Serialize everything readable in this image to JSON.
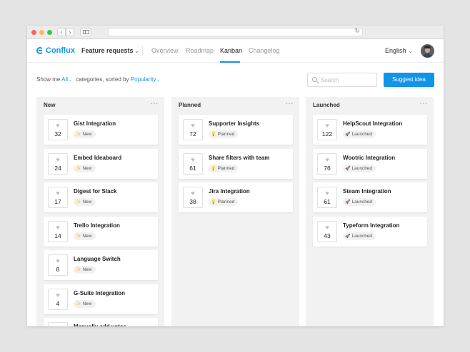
{
  "browser": {
    "back": "‹",
    "forward": "›",
    "reload": "↻"
  },
  "nav": {
    "logo": "Conflux",
    "product": "Feature requests",
    "tabs": [
      "Overview",
      "Roadmap",
      "Kanban",
      "Changelog"
    ],
    "active_tab": "Kanban",
    "language": "English",
    "chevron": "⌄"
  },
  "filter": {
    "prefix": "Show me",
    "category": "All",
    "middle": "categories, sorted by",
    "sort": "Popularity",
    "search_placeholder": "Search",
    "suggest_label": "Suggest idea"
  },
  "columns": [
    {
      "title": "New",
      "menu": "···",
      "cards": [
        {
          "title": "Gist Integration",
          "votes": "32",
          "status": "New",
          "status_icon": "✨"
        },
        {
          "title": "Embed Ideaboard",
          "votes": "24",
          "status": "New",
          "status_icon": "✨"
        },
        {
          "title": "Digest for Slack",
          "votes": "17",
          "status": "New",
          "status_icon": "✨"
        },
        {
          "title": "Trello Integration",
          "votes": "14",
          "status": "New",
          "status_icon": "✨"
        },
        {
          "title": "Language Switch",
          "votes": "8",
          "status": "New",
          "status_icon": "✨"
        },
        {
          "title": "G-Suite Integration",
          "votes": "4",
          "status": "New",
          "status_icon": "✨"
        },
        {
          "title": "Manually add votes",
          "votes": "",
          "status": "",
          "status_icon": ""
        }
      ]
    },
    {
      "title": "Planned",
      "menu": "···",
      "cards": [
        {
          "title": "Supporter Insights",
          "votes": "72",
          "status": "Planned",
          "status_icon": "💡"
        },
        {
          "title": "Share filters with team",
          "votes": "61",
          "status": "Planned",
          "status_icon": "💡"
        },
        {
          "title": "Jira Integration",
          "votes": "38",
          "status": "Planned",
          "status_icon": "💡"
        }
      ]
    },
    {
      "title": "Launched",
      "menu": "···",
      "cards": [
        {
          "title": "HelpScout Integration",
          "votes": "122",
          "status": "Launched",
          "status_icon": "🚀"
        },
        {
          "title": "Wootric Integration",
          "votes": "76",
          "status": "Launched",
          "status_icon": "🚀"
        },
        {
          "title": "Steam Integration",
          "votes": "61",
          "status": "Launched",
          "status_icon": "🚀"
        },
        {
          "title": "Typeform Integration",
          "votes": "43",
          "status": "Launched",
          "status_icon": "🚀"
        }
      ]
    }
  ],
  "icons": {
    "vote": "heart-icon",
    "heart_glyph": "♥"
  },
  "colors": {
    "accent": "#1294e8",
    "column_bg": "#f2f2f2"
  }
}
